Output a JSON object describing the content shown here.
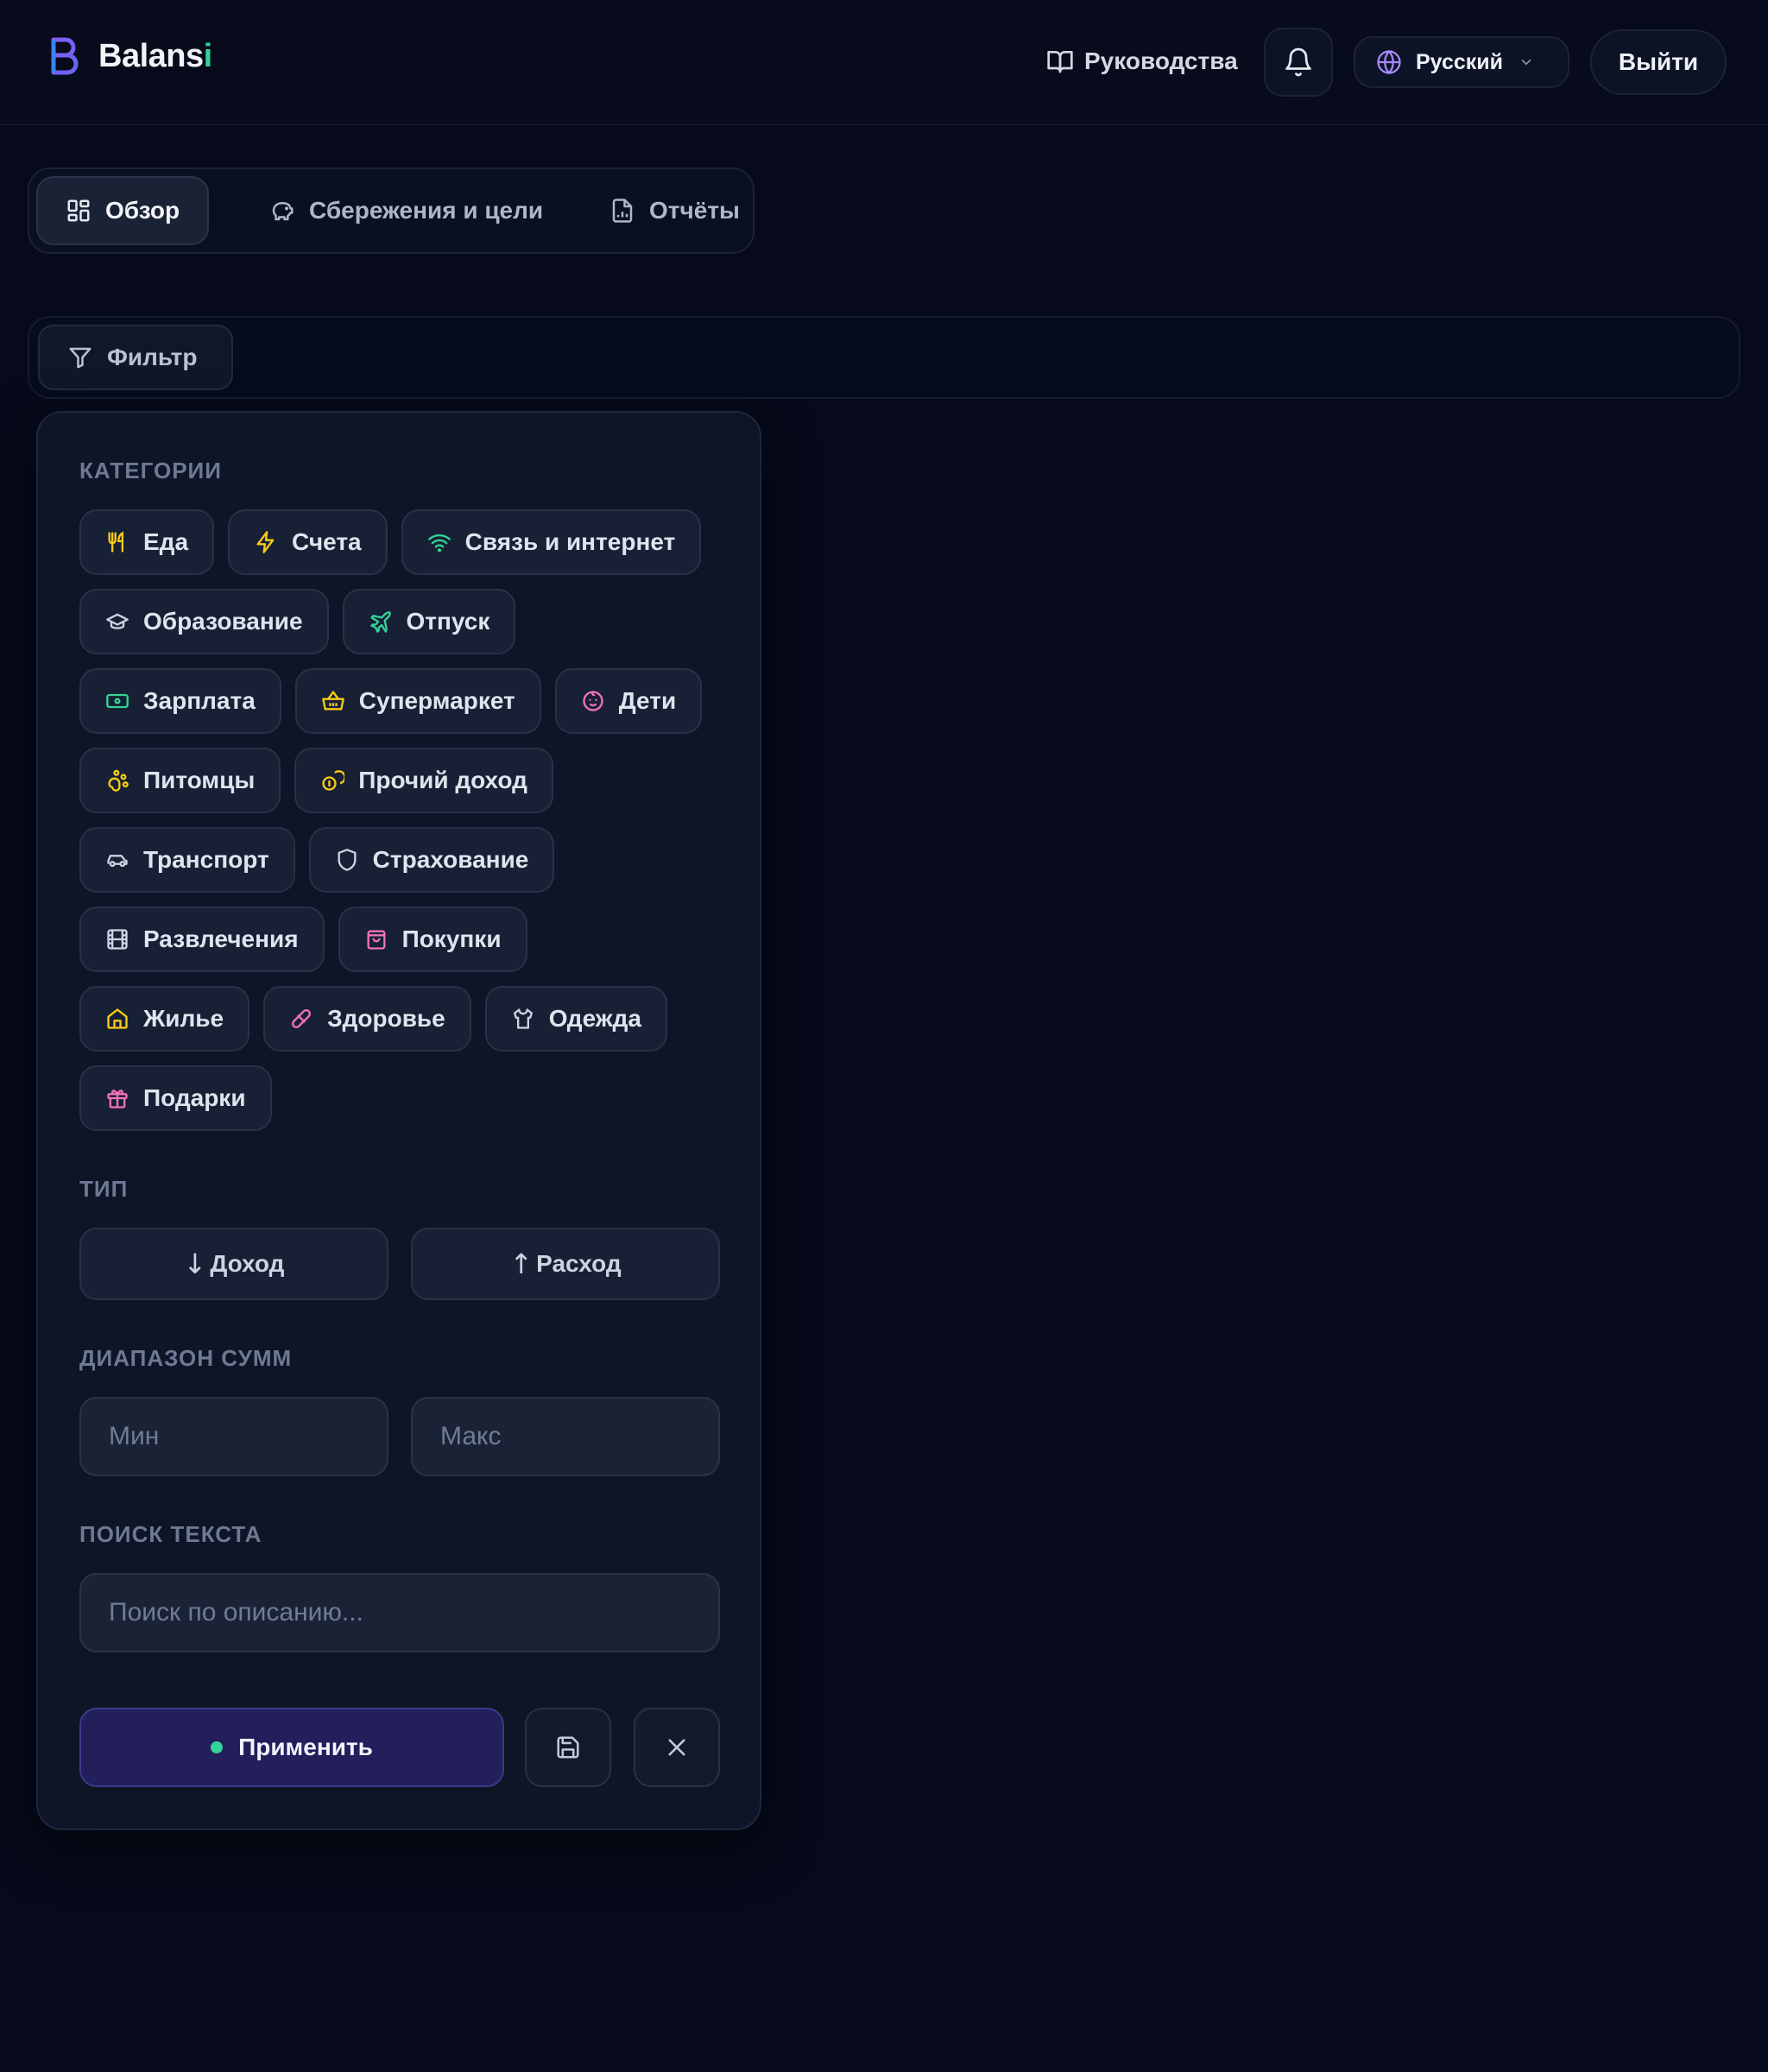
{
  "header": {
    "brand_main": "Balans",
    "brand_accent": "i",
    "guides_label": "Руководства",
    "language_label": "Русский",
    "logout_label": "Выйти"
  },
  "tabs": [
    {
      "label": "Обзор",
      "active": true
    },
    {
      "label": "Сбережения и цели",
      "active": false
    },
    {
      "label": "Отчёты",
      "active": false
    }
  ],
  "filter": {
    "button_label": "Фильтр",
    "categories_title": "КАТЕГОРИИ",
    "categories": [
      {
        "label": "Еда",
        "icon": "utensils-icon",
        "color": "#facc15"
      },
      {
        "label": "Счета",
        "icon": "bolt-icon",
        "color": "#facc15"
      },
      {
        "label": "Связь и интернет",
        "icon": "wifi-icon",
        "color": "#34d399"
      },
      {
        "label": "Образование",
        "icon": "graduation-cap-icon",
        "color": "#cbd5e1"
      },
      {
        "label": "Отпуск",
        "icon": "plane-icon",
        "color": "#34d399"
      },
      {
        "label": "Зарплата",
        "icon": "banknote-icon",
        "color": "#34d399"
      },
      {
        "label": "Супермаркет",
        "icon": "basket-icon",
        "color": "#facc15"
      },
      {
        "label": "Дети",
        "icon": "baby-icon",
        "color": "#f472b6"
      },
      {
        "label": "Питомцы",
        "icon": "paw-icon",
        "color": "#facc15"
      },
      {
        "label": "Прочий доход",
        "icon": "coins-icon",
        "color": "#facc15"
      },
      {
        "label": "Транспорт",
        "icon": "car-icon",
        "color": "#cbd5e1"
      },
      {
        "label": "Страхование",
        "icon": "shield-icon",
        "color": "#cbd5e1"
      },
      {
        "label": "Развлечения",
        "icon": "film-icon",
        "color": "#cbd5e1"
      },
      {
        "label": "Покупки",
        "icon": "shopping-bag-icon",
        "color": "#f472b6"
      },
      {
        "label": "Жилье",
        "icon": "home-icon",
        "color": "#facc15"
      },
      {
        "label": "Здоровье",
        "icon": "pill-icon",
        "color": "#f472b6"
      },
      {
        "label": "Одежда",
        "icon": "shirt-icon",
        "color": "#cbd5e1"
      },
      {
        "label": "Подарки",
        "icon": "gift-icon",
        "color": "#f472b6"
      }
    ],
    "type_title": "ТИП",
    "type_income": "Доход",
    "type_expense": "Расход",
    "range_title": "ДИАПАЗОН СУММ",
    "min_placeholder": "Мин",
    "max_placeholder": "Макс",
    "search_title": "ПОИСК ТЕКСТА",
    "search_placeholder": "Поиск по описанию...",
    "apply_label": "Применить"
  },
  "colors": {
    "accent_green": "#34d399",
    "accent_purple": "#8b5cf6",
    "background": "#060a1a",
    "panel": "#0e1526"
  }
}
